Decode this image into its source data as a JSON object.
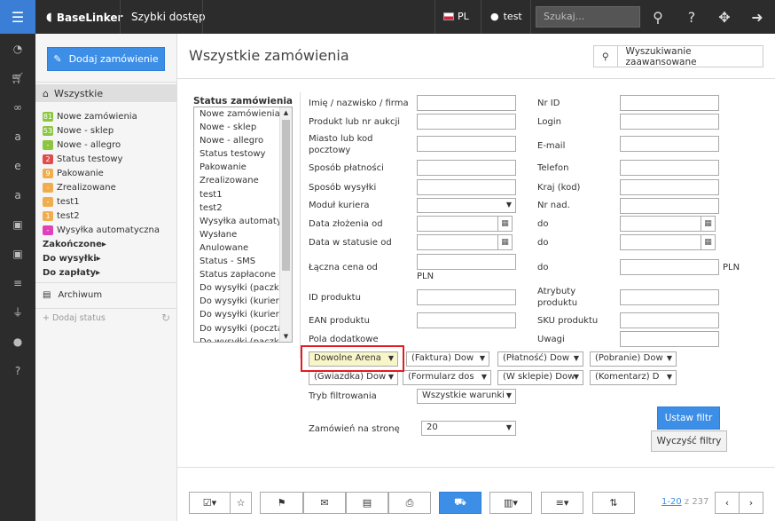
{
  "topbar": {
    "menu_icon": "menu-icon",
    "brand": "BaseLinker",
    "quick_access": "Szybki dostęp",
    "lang": "PL",
    "user": "test",
    "search_placeholder": "Szukaj...",
    "icons": [
      "search-icon",
      "help-icon",
      "move-icon",
      "logout-icon"
    ]
  },
  "leftnav_icons": [
    "dashboard-icon",
    "cart-icon",
    "link-icon",
    "amazon-icon",
    "ebay-icon",
    "amazon2-icon",
    "bag-icon",
    "bag2-icon",
    "database-icon",
    "plug-icon",
    "user-icon",
    "help-icon"
  ],
  "sidebar": {
    "add_order": "Dodaj zamówienie",
    "all": "Wszystkie",
    "items": [
      {
        "badge": "81",
        "color": "#8cc63f",
        "label": "Nowe zamówienia"
      },
      {
        "badge": "53",
        "color": "#8cc63f",
        "label": "Nowe - sklep"
      },
      {
        "badge": "-",
        "color": "#8cc63f",
        "label": "Nowe - allegro"
      },
      {
        "badge": "2",
        "color": "#e04b4b",
        "label": "Status testowy"
      },
      {
        "badge": "9",
        "color": "#f0ad4e",
        "label": "Pakowanie"
      },
      {
        "badge": "-",
        "color": "#f0ad4e",
        "label": "Zrealizowane"
      },
      {
        "badge": "-",
        "color": "#f0ad4e",
        "label": "test1"
      },
      {
        "badge": "1",
        "color": "#f0ad4e",
        "label": "test2"
      },
      {
        "badge": "-",
        "color": "#e040b8",
        "label": "Wysyłka automatyczna"
      }
    ],
    "groups": [
      "Zakończone",
      "Do wysyłki",
      "Do zapłaty"
    ],
    "archive": "Archiwum",
    "add_status": "+ Dodaj status"
  },
  "main": {
    "title": "Wszystkie zamówienia",
    "advanced_search": "Wyszukiwanie zaawansowane",
    "status_label": "Status zamówienia",
    "status_list": [
      "Nowe zamówienia",
      "Nowe - sklep",
      "Nowe - allegro",
      "Status testowy",
      "Pakowanie",
      "Zrealizowane",
      "test1",
      "test2",
      "Wysyłka automaty",
      "Wysłane",
      "Anulowane",
      "Status - SMS",
      "Status zapłacone",
      "Do wysyłki (paczko",
      "Do wysyłki (kurier",
      "Do wysyłki (kurier)",
      "Do wysyłki (poczta",
      "Do wysyłki (paczk"
    ],
    "left_fields": {
      "name": "Imię / nazwisko / firma",
      "product": "Produkt lub nr aukcji",
      "city": "Miasto lub kod pocztowy",
      "payment": "Sposób płatności",
      "shipping": "Sposób wysyłki",
      "courier": "Moduł kuriera",
      "date_created": "Data złożenia od",
      "date_status": "Data w statusie od",
      "total": "Łączna cena od",
      "currency": "PLN",
      "product_id": "ID produktu",
      "ean": "EAN produktu",
      "extra": "Pola dodatkowe"
    },
    "right_fields": {
      "id": "Nr ID",
      "login": "Login",
      "email": "E-mail",
      "phone": "Telefon",
      "country": "Kraj (kod)",
      "tracking": "Nr nad.",
      "to": "do",
      "attributes": "Atrybuty produktu",
      "sku": "SKU produktu",
      "notes": "Uwagi"
    },
    "extra_selects": [
      "Dowolne Arena",
      "(Faktura) Dow",
      "(Płatność) Dow",
      "(Pobranie) Dow",
      "(Gwiazdka) Dow",
      "(Formularz dos",
      "(W sklepie) Dow",
      "(Komentarz) D"
    ],
    "filter_mode_label": "Tryb filtrowania",
    "filter_mode_value": "Wszystkie warunki",
    "per_page_label": "Zamówień na stronę",
    "per_page_value": "20",
    "apply_filter": "Ustaw filtr",
    "clear_filters": "Wyczyść filtry",
    "pager_range": "1-20",
    "pager_of": "z 237"
  },
  "toolbar_icons": [
    "checkbox-icon",
    "star-icon",
    "flag-icon",
    "mail-icon",
    "document-icon",
    "print-icon",
    "truck-icon",
    "package-icon",
    "list-icon",
    "sort-icon",
    "prev-icon",
    "next-icon"
  ]
}
